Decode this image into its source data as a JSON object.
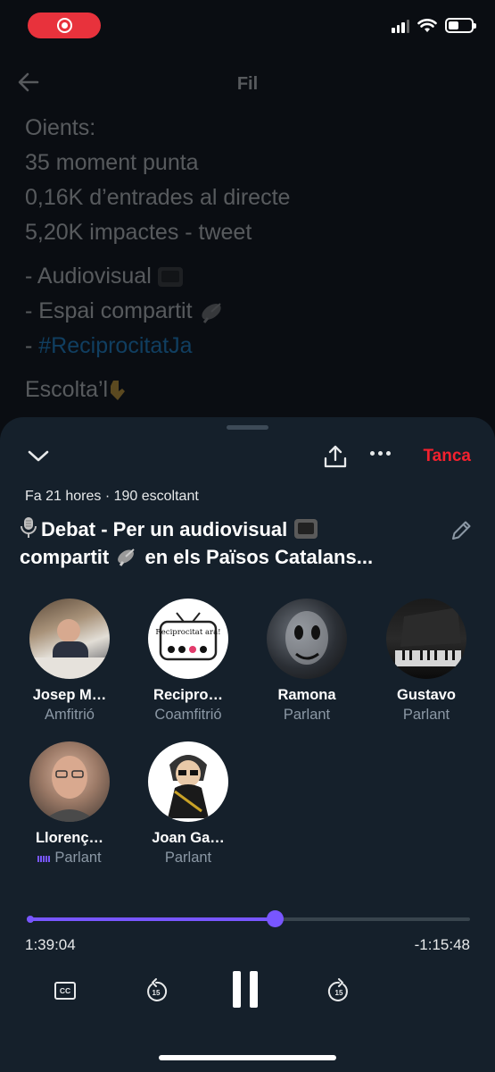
{
  "status_bar": {
    "recording_icon": "screen-recording-icon",
    "signal_icon": "cellular-signal-icon",
    "wifi_icon": "wifi-icon",
    "battery_icon": "battery-icon",
    "battery_level": 0.45
  },
  "background_tweet": {
    "header_title": "Fil",
    "lines": [
      "Oients:",
      "35 moment punta",
      "0,16K d’entrades al directe",
      "5,20K impactes - tweet"
    ],
    "items": [
      "- Audiovisual",
      "- Espai compartit",
      "- "
    ],
    "hashtag": "#ReciprocitatJa",
    "closing": "Escolta’l"
  },
  "space": {
    "close_label": "Tanca",
    "meta": "Fa 21 hores · 190 escoltant",
    "title_part1": "Debat - Per un audiovisual",
    "title_part2": "compartit",
    "title_part3": "en els Països Catalans...",
    "speakers": [
      {
        "name": "Josep M…",
        "role": "Amfitrió",
        "speaking": false
      },
      {
        "name": "Recipro…",
        "role": "Coamfitrió",
        "speaking": false
      },
      {
        "name": "Ramona",
        "role": "Parlant",
        "speaking": false
      },
      {
        "name": "Gustavo",
        "role": "Parlant",
        "speaking": false
      },
      {
        "name": "Llorenç…",
        "role": "Parlant",
        "speaking": true
      },
      {
        "name": "Joan Ga…",
        "role": "Parlant",
        "speaking": false
      }
    ],
    "avatar_badge_text": "Reciprocitat ara!",
    "playback": {
      "elapsed": "1:39:04",
      "remaining": "-1:15:48",
      "progress": 0.561,
      "skip_back_label": "15",
      "skip_forward_label": "15",
      "cc_label": "CC"
    }
  },
  "colors": {
    "accent": "#7856ff",
    "close": "#f4212e",
    "sheet_bg": "#15202b",
    "hashtag": "#1d9bf0"
  }
}
